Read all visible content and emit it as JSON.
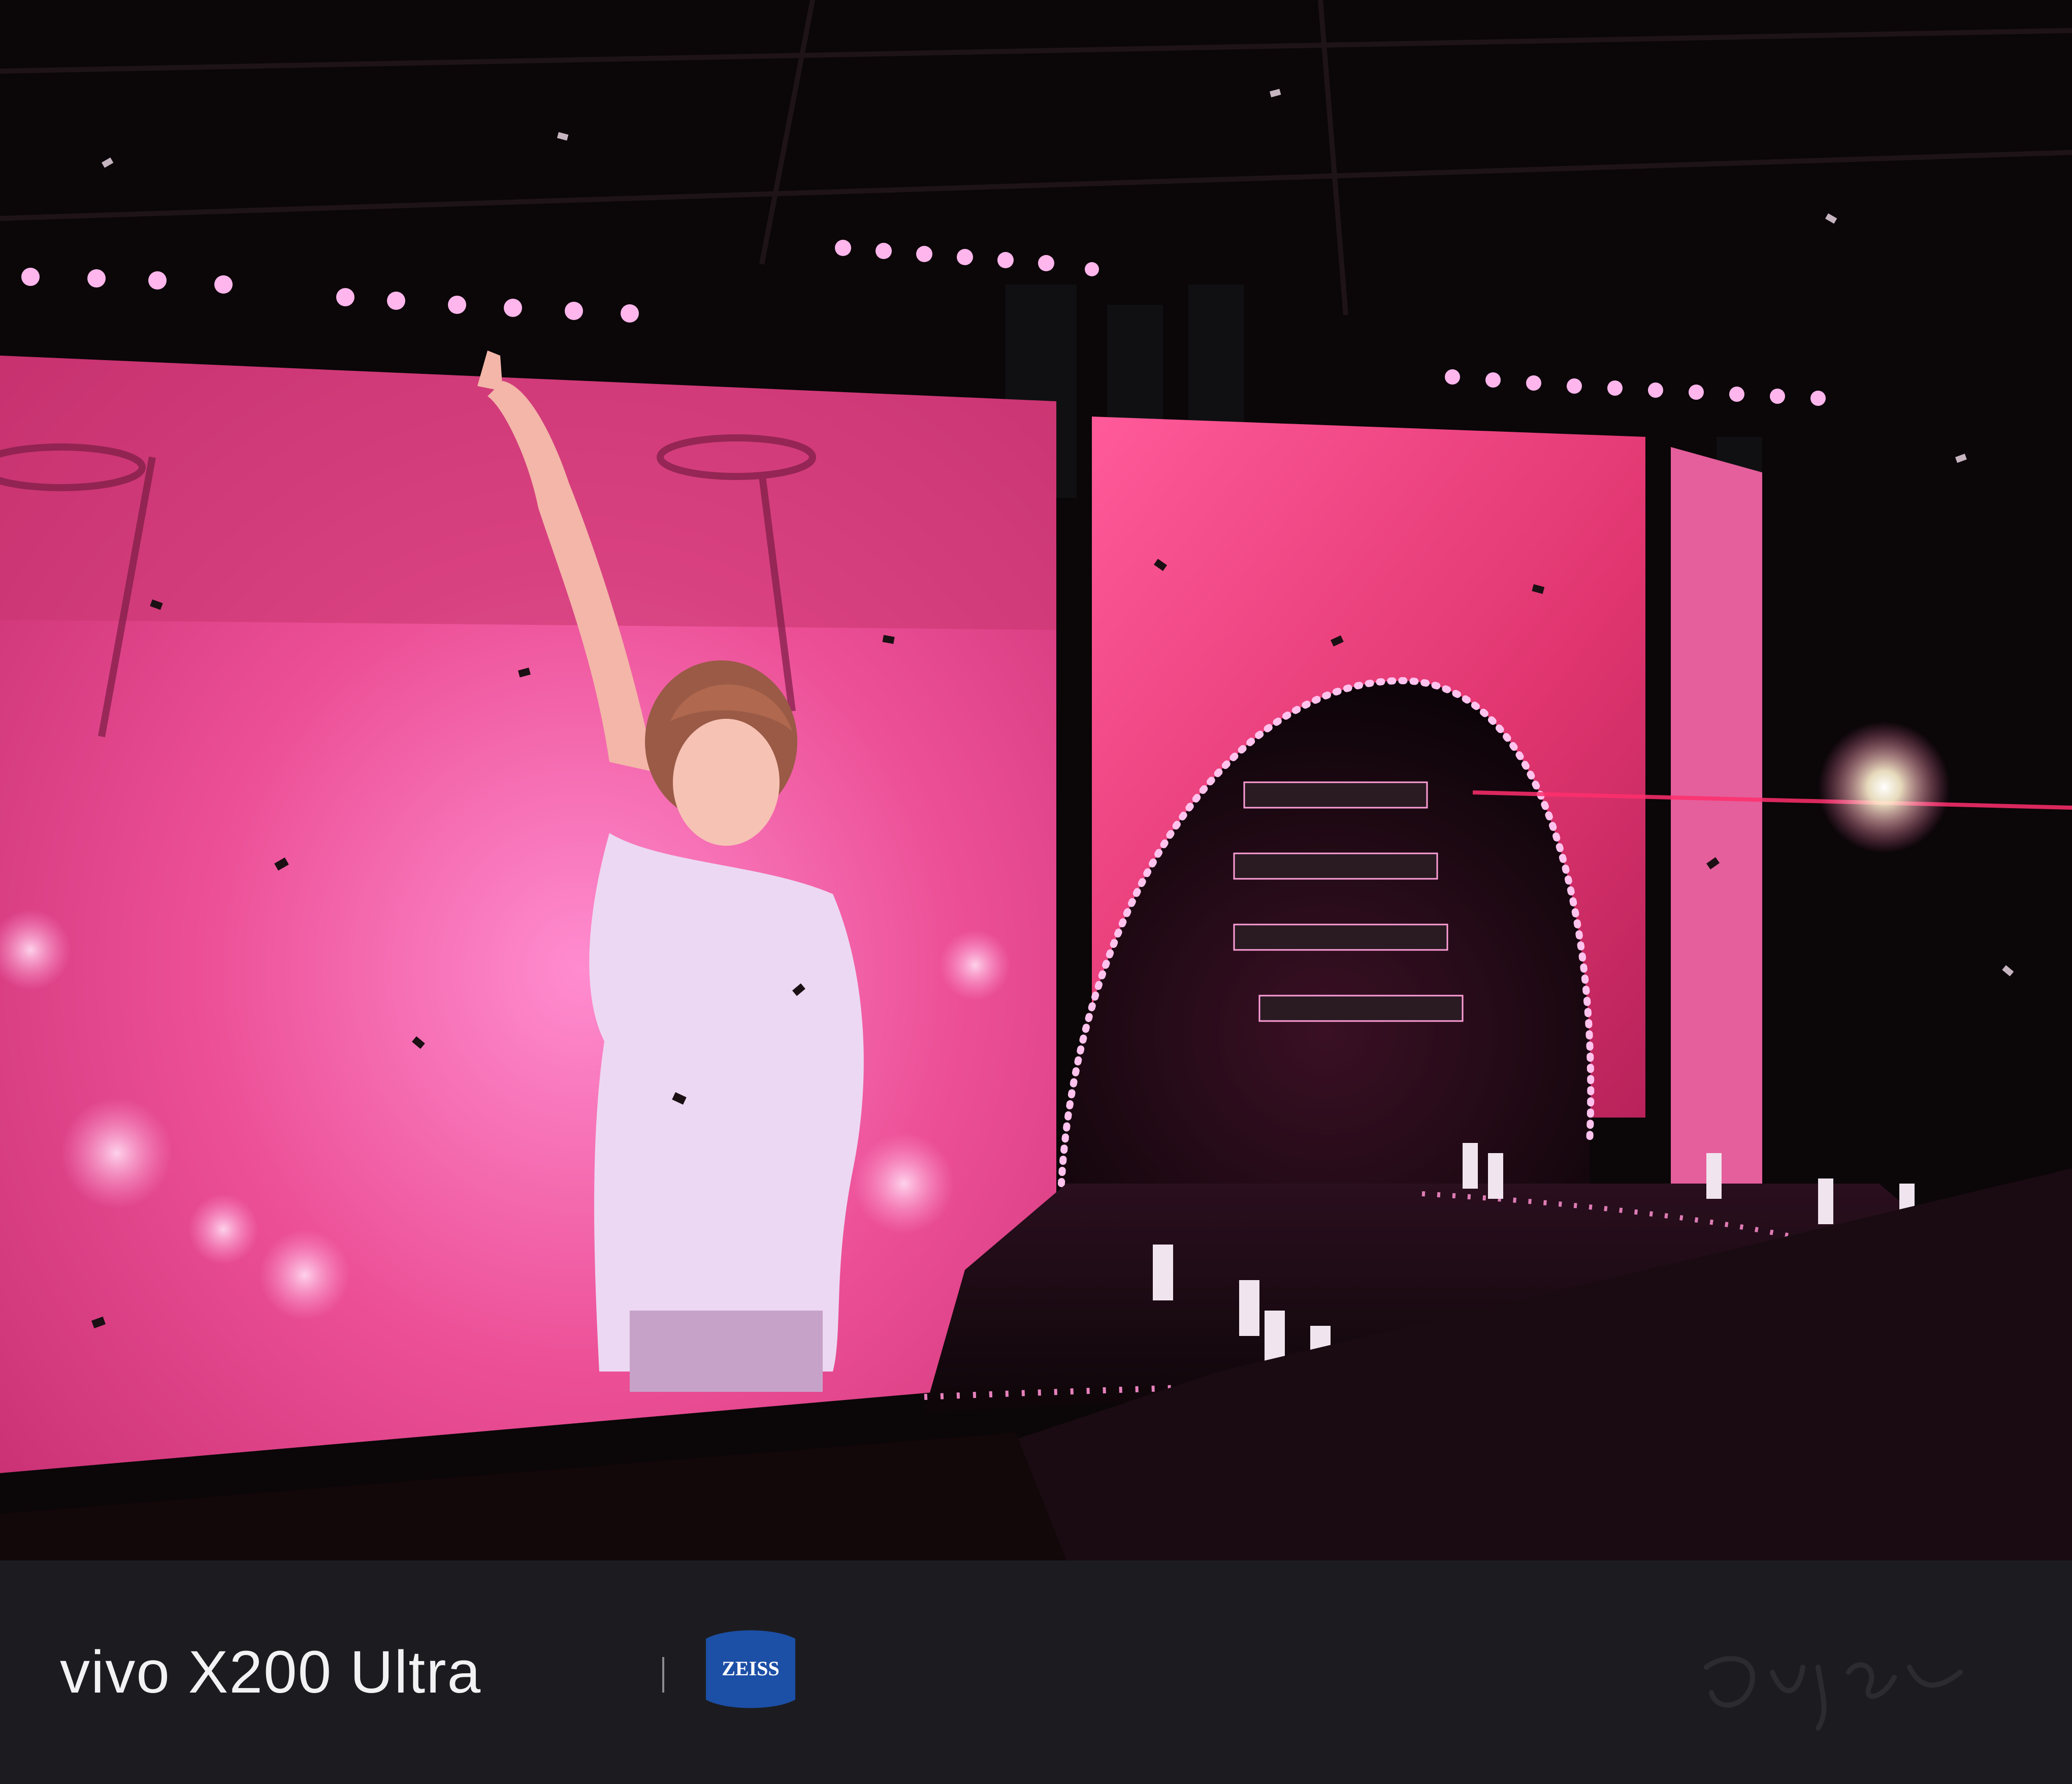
{
  "watermark": {
    "brand": "vivo X200 Ultra",
    "lens_partner": "ZEISS"
  },
  "colors": {
    "bar_background": "#1c1c20",
    "brand_text": "#f2f2f4",
    "zeiss_blue": "#1c4fa6",
    "screen_magenta": "#e8458a",
    "led_pink": "#ff7ad0"
  },
  "photo": {
    "subject": "concert-stage",
    "elements": [
      "led-video-wall",
      "performer-closeup",
      "arched-stage-screen",
      "confetti",
      "crowd",
      "lighting-truss"
    ]
  }
}
